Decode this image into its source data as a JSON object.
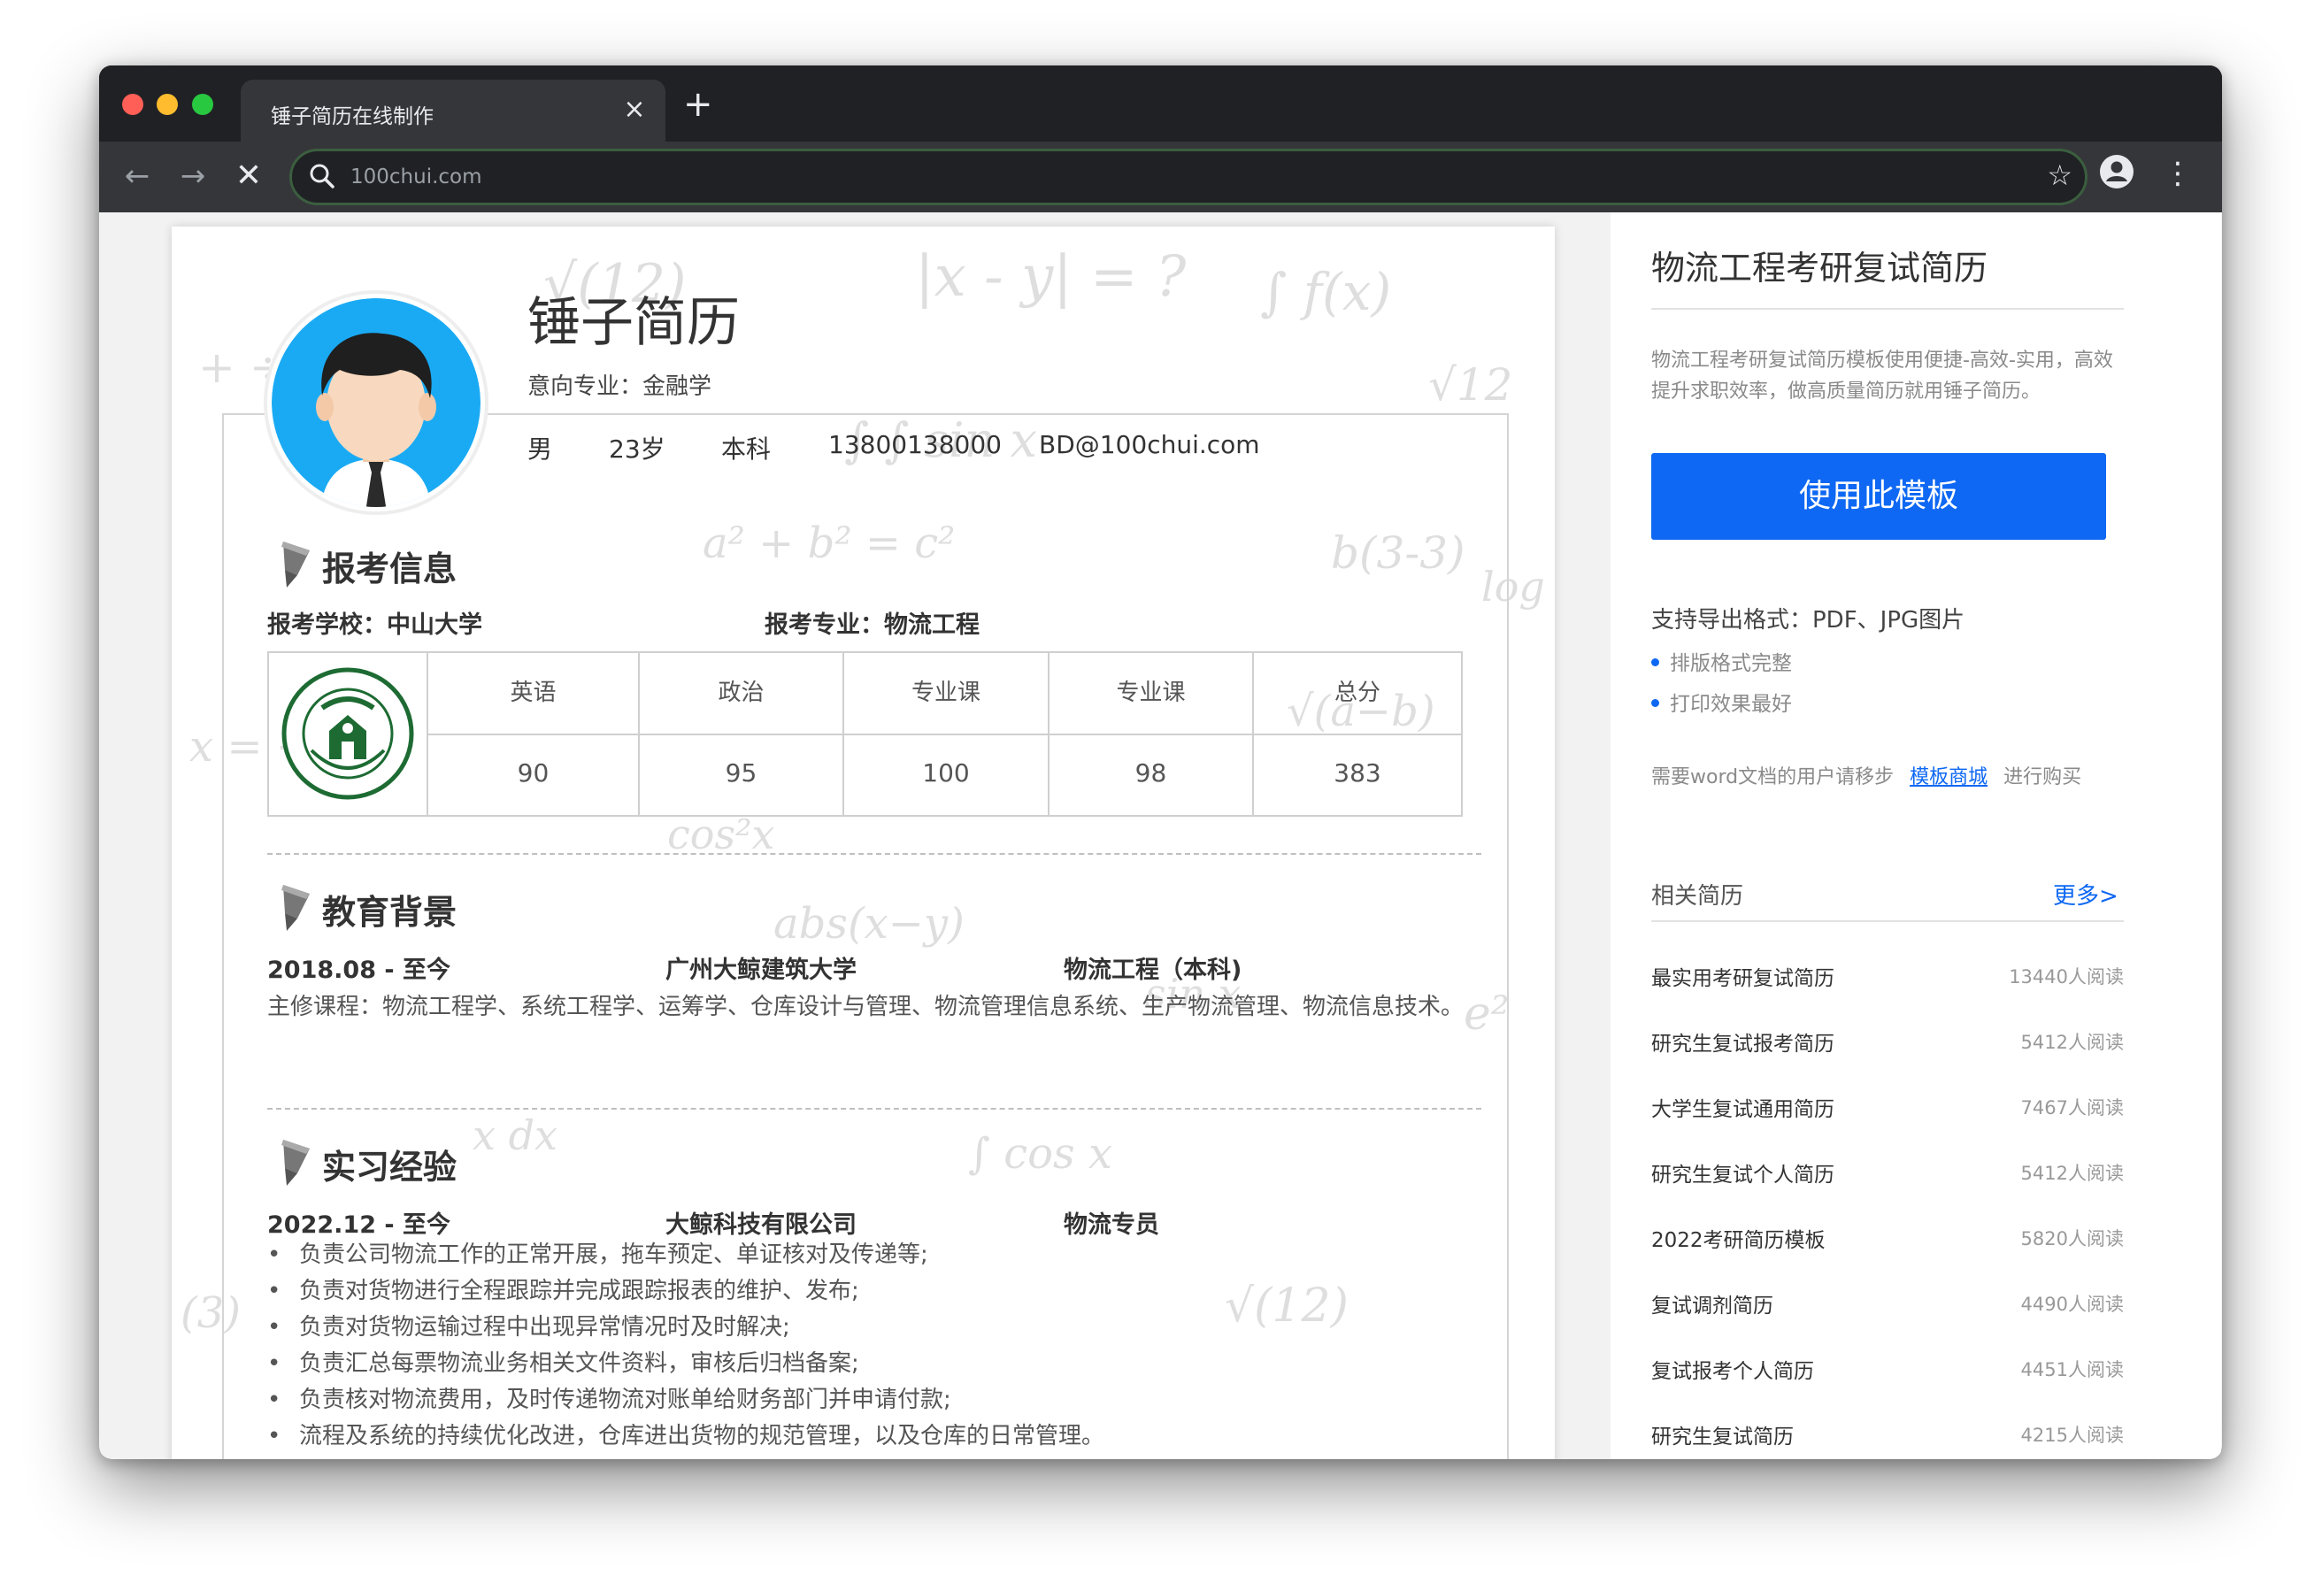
{
  "browser": {
    "tab_title": "锤子简历在线制作",
    "tab_close": "×",
    "new_tab": "+",
    "url": "100chui.com",
    "colors": {
      "frame": "#202124",
      "toolbar": "#35363a",
      "omnibox_border": "#3b5e3f"
    }
  },
  "resume": {
    "name": "锤子简历",
    "intended_major": "意向专业：金融学",
    "info": [
      "男",
      "23岁",
      "本科",
      "13800138000",
      "BD@100chui.com"
    ],
    "sections": {
      "exam_info": "报考信息",
      "education": "教育背景",
      "internship": "实习经验"
    },
    "exam": {
      "school": "报考学校：中山大学",
      "major": "报考专业：物流工程",
      "headers": [
        "英语",
        "政治",
        "专业课",
        "专业课",
        "总分"
      ],
      "scores": [
        "90",
        "95",
        "100",
        "98",
        "383"
      ],
      "logo": "中山大学 SUN YAT-SEN UNIVERSITY"
    },
    "education": {
      "period": "2018.08 - 至今",
      "school": "广州大鲸建筑大学",
      "degree": "物流工程（本科)",
      "courses": "主修课程：物流工程学、系统工程学、运筹学、仓库设计与管理、物流管理信息系统、生产物流管理、物流信息技术。"
    },
    "internship": {
      "period": "2022.12 - 至今",
      "company": "大鲸科技有限公司",
      "role": "物流专员",
      "duties": [
        "负责公司物流工作的正常开展，拖车预定、单证核对及传递等;",
        "负责对货物进行全程跟踪并完成跟踪报表的维护、发布;",
        "负责对货物运输过程中出现异常情况时及时解决;",
        "负责汇总每票物流业务相关文件资料，审核后归档备案;",
        "负责核对物流费用，及时传递物流对账单给财务部门并申请付款;",
        "流程及系统的持续优化改进，仓库进出货物的规范管理，以及仓库的日常管理。"
      ]
    }
  },
  "sidebar": {
    "title": "物流工程考研复试简历",
    "description": "物流工程考研复试简历模板使用便捷-高效-实用，高效提升求职效率，做高质量简历就用锤子简历。",
    "use_button": "使用此模板",
    "export_formats": "支持导出格式：PDF、JPG图片",
    "features": [
      "排版格式完整",
      "打印效果最好"
    ],
    "word_note_prefix": "需要word文档的用户请移步",
    "word_note_link": "模板商城",
    "word_note_suffix": "进行购买",
    "related_title": "相关简历",
    "more": "更多>",
    "related": [
      {
        "title": "最实用考研复试简历",
        "reads": "13440人阅读"
      },
      {
        "title": "研究生复试报考简历",
        "reads": "5412人阅读"
      },
      {
        "title": "大学生复试通用简历",
        "reads": "7467人阅读"
      },
      {
        "title": "研究生复试个人简历",
        "reads": "5412人阅读"
      },
      {
        "title": "2022考研简历模板",
        "reads": "5820人阅读"
      },
      {
        "title": "复试调剂简历",
        "reads": "4490人阅读"
      },
      {
        "title": "复试报考个人简历",
        "reads": "4451人阅读"
      },
      {
        "title": "研究生复试简历",
        "reads": "4215人阅读"
      }
    ],
    "accent_color": "#0e68f3"
  }
}
